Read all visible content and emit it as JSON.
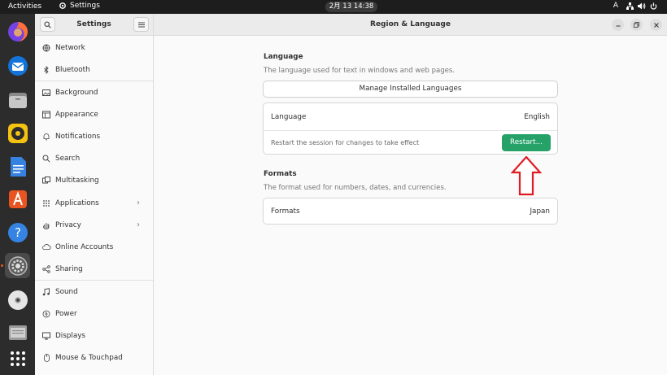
{
  "topbar": {
    "activities": "Activities",
    "app_name": "Settings",
    "clock": "2月 13  14:38",
    "input_method": "A"
  },
  "dock": {
    "items": [
      {
        "name": "firefox-icon"
      },
      {
        "name": "thunderbird-icon"
      },
      {
        "name": "files-icon"
      },
      {
        "name": "rhythmbox-icon"
      },
      {
        "name": "libreoffice-writer-icon"
      },
      {
        "name": "app-center-icon"
      },
      {
        "name": "help-icon"
      },
      {
        "name": "settings-icon"
      },
      {
        "name": "disc-icon"
      },
      {
        "name": "trash-icon"
      },
      {
        "name": "show-apps-icon"
      }
    ]
  },
  "sidebar": {
    "title": "Settings",
    "items": [
      {
        "label": "Network",
        "icon": "network-icon"
      },
      {
        "label": "Bluetooth",
        "icon": "bluetooth-icon"
      },
      {
        "label": "Background",
        "icon": "background-icon"
      },
      {
        "label": "Appearance",
        "icon": "appearance-icon"
      },
      {
        "label": "Notifications",
        "icon": "bell-icon"
      },
      {
        "label": "Search",
        "icon": "search-icon"
      },
      {
        "label": "Multitasking",
        "icon": "multitasking-icon"
      },
      {
        "label": "Applications",
        "icon": "grid-icon",
        "chevron": "›"
      },
      {
        "label": "Privacy",
        "icon": "hand-icon",
        "chevron": "›"
      },
      {
        "label": "Online Accounts",
        "icon": "cloud-icon"
      },
      {
        "label": "Sharing",
        "icon": "share-icon"
      },
      {
        "label": "Sound",
        "icon": "music-note-icon"
      },
      {
        "label": "Power",
        "icon": "power-icon"
      },
      {
        "label": "Displays",
        "icon": "display-icon"
      },
      {
        "label": "Mouse & Touchpad",
        "icon": "mouse-icon"
      }
    ]
  },
  "main": {
    "title": "Region & Language",
    "language_section": {
      "title": "Language",
      "description": "The language used for text in windows and web pages.",
      "manage_button": "Manage Installed Languages",
      "language_label": "Language",
      "language_value": "English",
      "restart_note": "Restart the session for changes to take effect",
      "restart_button": "Restart..."
    },
    "formats_section": {
      "title": "Formats",
      "description": "The format used for numbers, dates, and currencies.",
      "formats_label": "Formats",
      "formats_value": "Japan"
    }
  },
  "colors": {
    "restart_button": "#26a269",
    "annotation_arrow": "#e01b24",
    "dock_background": "#2c2c2c",
    "topbar_background": "#1d1d1d"
  }
}
